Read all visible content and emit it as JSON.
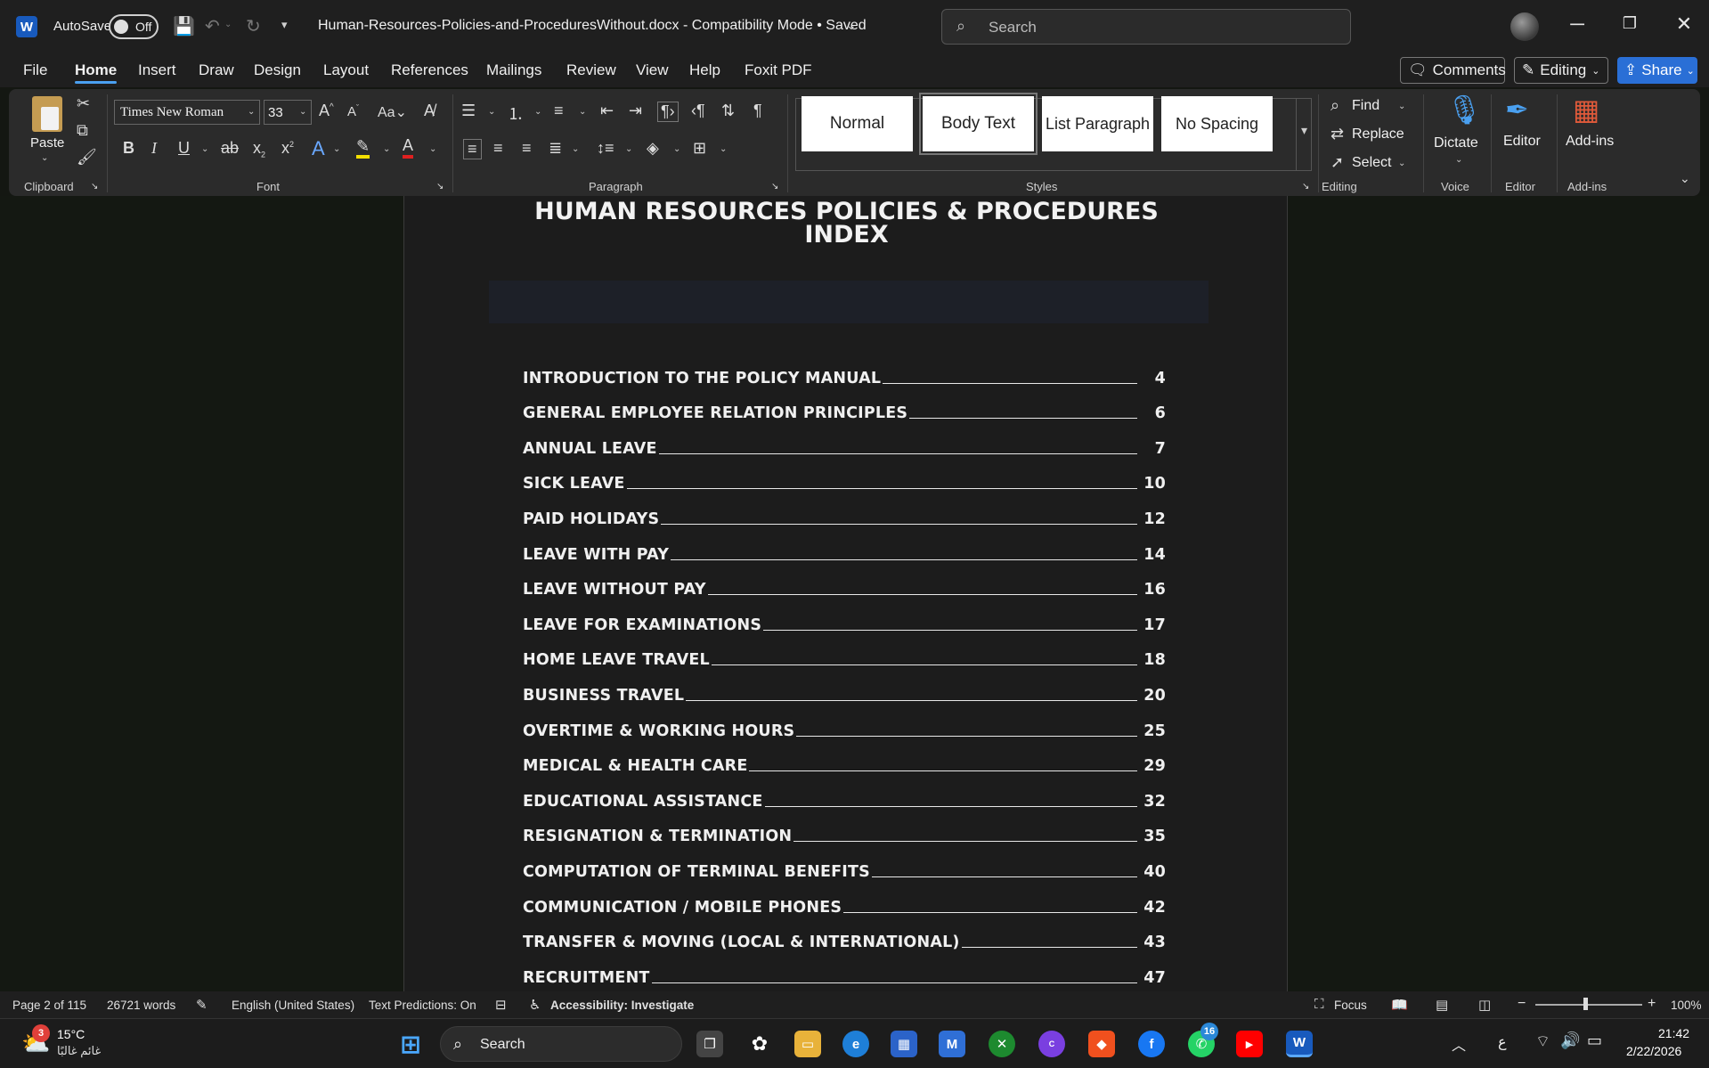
{
  "titlebar": {
    "app_logo": "W",
    "autosave_label": "AutoSave",
    "autosave_state": "Off",
    "doc_title": "Human-Resources-Policies-and-ProceduresWithout.docx  -  Compatibility Mode  •  Saved",
    "search_placeholder": "Search"
  },
  "menu": {
    "items": [
      "File",
      "Home",
      "Insert",
      "Draw",
      "Design",
      "Layout",
      "References",
      "Mailings",
      "Review",
      "View",
      "Help",
      "Foxit PDF"
    ],
    "comments_label": "Comments",
    "editing_label": "Editing",
    "share_label": "Share"
  },
  "ribbon": {
    "paste_label": "Paste",
    "font_name": "Times New Roman",
    "font_size": "33",
    "groups": {
      "clipboard": "Clipboard",
      "font": "Font",
      "paragraph": "Paragraph",
      "styles": "Styles",
      "editing": "Editing",
      "voice": "Voice",
      "editor": "Editor",
      "addins": "Add-ins"
    },
    "styles": [
      "Normal",
      "Body Text",
      "List Paragraph",
      "No Spacing"
    ],
    "find_label": "Find",
    "replace_label": "Replace",
    "select_label": "Select",
    "dictate_label": "Dictate",
    "editor_label": "Editor",
    "addins_label": "Add-ins"
  },
  "document": {
    "title_line1": "HUMAN RESOURCES POLICIES & PROCEDURES",
    "title_line2": "INDEX",
    "toc": [
      {
        "title": "INTRODUCTION TO THE POLICY MANUAL",
        "page": "4"
      },
      {
        "title": "GENERAL EMPLOYEE RELATION PRINCIPLES",
        "page": "6"
      },
      {
        "title": "ANNUAL LEAVE",
        "page": "7"
      },
      {
        "title": "SICK LEAVE",
        "page": "10"
      },
      {
        "title": "PAID HOLIDAYS",
        "page": "12"
      },
      {
        "title": "LEAVE WITH PAY",
        "page": "14"
      },
      {
        "title": "LEAVE WITHOUT PAY",
        "page": "16"
      },
      {
        "title": "LEAVE FOR EXAMINATIONS",
        "page": "17"
      },
      {
        "title": "HOME LEAVE TRAVEL",
        "page": "18"
      },
      {
        "title": "BUSINESS TRAVEL",
        "page": "20"
      },
      {
        "title": "OVERTIME & WORKING HOURS",
        "page": "25"
      },
      {
        "title": "MEDICAL & HEALTH CARE",
        "page": "29"
      },
      {
        "title": "EDUCATIONAL ASSISTANCE",
        "page": "32"
      },
      {
        "title": "RESIGNATION & TERMINATION",
        "page": "35"
      },
      {
        "title": "COMPUTATION OF TERMINAL BENEFITS",
        "page": "40"
      },
      {
        "title": "COMMUNICATION / MOBILE PHONES",
        "page": "42"
      },
      {
        "title": "TRANSFER & MOVING (LOCAL & INTERNATIONAL)",
        "page": "43"
      },
      {
        "title": "RECRUITMENT",
        "page": "47"
      }
    ]
  },
  "status": {
    "page": "Page 2 of 115",
    "words": "26721 words",
    "language": "English (United States)",
    "predictions": "Text Predictions: On",
    "accessibility": "Accessibility: Investigate",
    "focus": "Focus",
    "zoom": "100%",
    "zoom_level": 1.0
  },
  "taskbar": {
    "weather_temp": "15°C",
    "weather_desc": "غائم غالبًا",
    "weather_badge": "3",
    "search_label": "Search",
    "whatsapp_badge": "16",
    "ime": "ع",
    "time": "21:42",
    "date": "2/22/2026"
  },
  "colors": {
    "accent": "#4aa0f0",
    "share": "#2a6fd6",
    "word_blue": "#185abd"
  }
}
